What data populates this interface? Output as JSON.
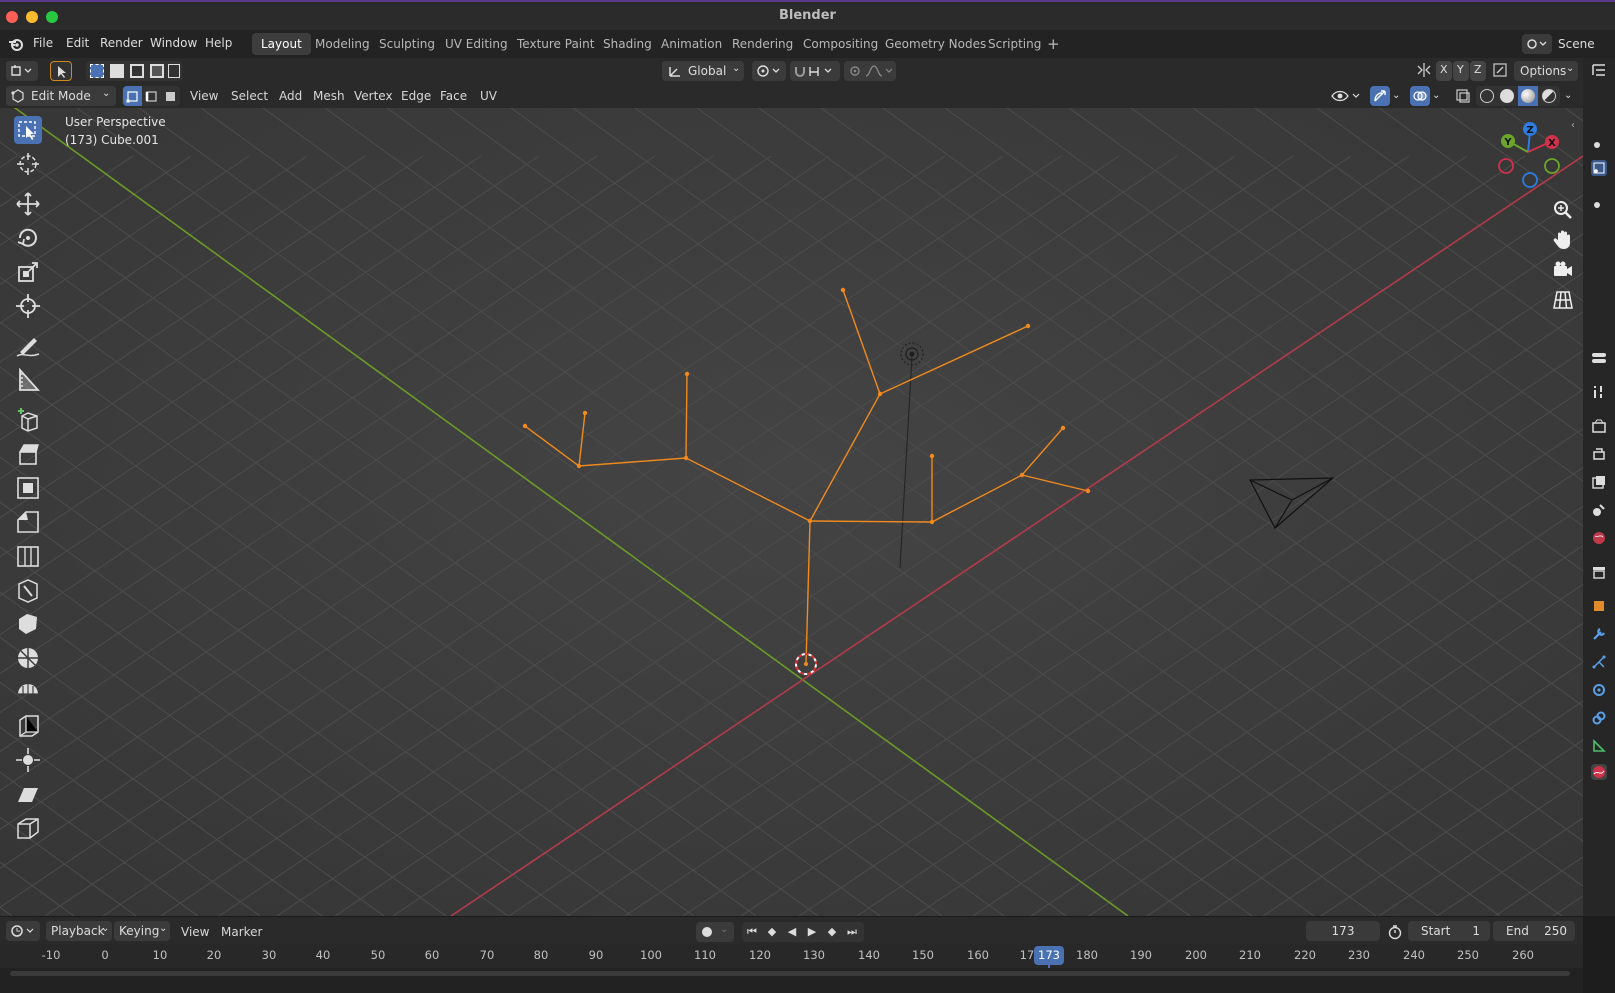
{
  "window": {
    "title": "Blender"
  },
  "menubar": {
    "items": [
      "File",
      "Edit",
      "Render",
      "Window",
      "Help"
    ]
  },
  "workspaces": [
    "Layout",
    "Modeling",
    "Sculpting",
    "UV Editing",
    "Texture Paint",
    "Shading",
    "Animation",
    "Rendering",
    "Compositing",
    "Geometry Nodes",
    "Scripting"
  ],
  "active_workspace": "Layout",
  "scene_name": "Scene",
  "header": {
    "orientation": "Global",
    "axes": [
      "X",
      "Y",
      "Z"
    ],
    "options_label": "Options",
    "mode": "Edit Mode",
    "menus": [
      "View",
      "Select",
      "Add",
      "Mesh",
      "Vertex",
      "Edge",
      "Face",
      "UV"
    ]
  },
  "viewport": {
    "perspective_label": "User Perspective",
    "object_label": "(173) Cube.001",
    "gizmo_axes": [
      "X",
      "Y",
      "Z"
    ],
    "colors": {
      "background": "#3d3d3d",
      "x_axis": "#b33b4a",
      "y_axis": "#6b9a27",
      "mesh_edge": "#f08a1d"
    }
  },
  "timeline": {
    "menus": [
      "Playback",
      "Keying",
      "View",
      "Marker"
    ],
    "current_frame": "173",
    "start_label": "Start",
    "start_value": "1",
    "end_label": "End",
    "end_value": "250",
    "ruler_ticks": [
      "-10",
      "0",
      "10",
      "20",
      "30",
      "40",
      "50",
      "60",
      "70",
      "80",
      "90",
      "100",
      "110",
      "120",
      "130",
      "140",
      "150",
      "160",
      "17",
      "173",
      "180",
      "190",
      "200",
      "210",
      "220",
      "230",
      "240",
      "250",
      "260"
    ]
  }
}
